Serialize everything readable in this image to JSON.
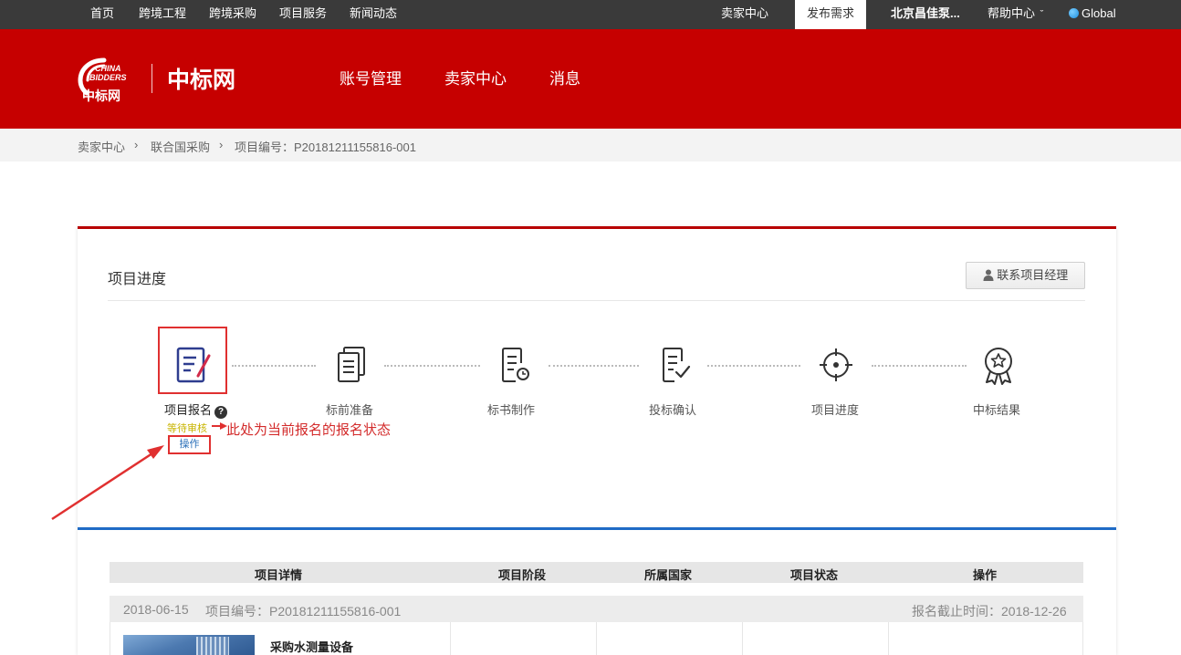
{
  "topbar": {
    "nav": [
      "首页",
      "跨境工程",
      "跨境采购",
      "项目服务",
      "新闻动态"
    ],
    "seller_center": "卖家中心",
    "publish": "发布需求",
    "company": "北京昌佳泵...",
    "help": "帮助中心",
    "help_chevron": "ˇ",
    "globe_icon": "globe-icon",
    "global": "Global"
  },
  "header": {
    "logo_mark_text_1": "CHINA",
    "logo_mark_text_2": "BIDDERS",
    "logo_mark_cn": "中标网",
    "logo_name": "中标网",
    "nav": [
      "账号管理",
      "卖家中心",
      "消息"
    ],
    "bg_color": "#c60000"
  },
  "breadcrumb": {
    "items": [
      "卖家中心",
      "联合国采购",
      "项目编号：P20181211155816-001"
    ],
    "separator": "›"
  },
  "progress": {
    "title": "项目进度",
    "contact_button": "联系项目经理",
    "contact_icon": "user-icon",
    "steps": [
      {
        "label": "项目报名",
        "icon": "edit-document-icon"
      },
      {
        "label": "标前准备",
        "icon": "documents-icon"
      },
      {
        "label": "标书制作",
        "icon": "document-clock-icon"
      },
      {
        "label": "投标确认",
        "icon": "document-check-icon"
      },
      {
        "label": "项目进度",
        "icon": "crosshair-icon"
      },
      {
        "label": "中标结果",
        "icon": "award-icon"
      }
    ],
    "help_mark": "?",
    "status": "等待审核",
    "operation": "操作",
    "annotation": "此处为当前报名的报名状态",
    "accent_color": "#b80000",
    "annotation_color": "#e03030"
  },
  "table": {
    "headers": [
      "项目详情",
      "项目阶段",
      "所属国家",
      "项目状态",
      "操作"
    ],
    "group": {
      "date": "2018-06-15",
      "project_no": "项目编号：P20181211155816-001",
      "deadline": "报名截止时间：2018-12-26"
    },
    "rows": [
      {
        "name": "采购水测量设备"
      }
    ],
    "accent_color": "#1f6bc6"
  }
}
